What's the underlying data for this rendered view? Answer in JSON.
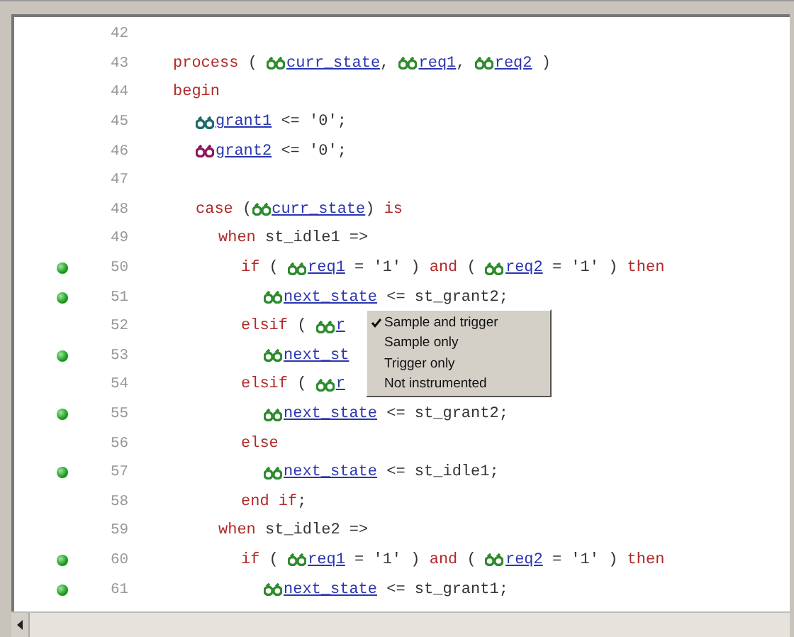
{
  "editor": {
    "lines": [
      {
        "number": "42",
        "breakpoint": false
      },
      {
        "number": "43",
        "breakpoint": false,
        "tokens": [
          {
            "kind": "keyword",
            "text": "process"
          },
          {
            "kind": "plain",
            "text": " ( "
          },
          {
            "kind": "signal",
            "text": "curr_state",
            "color": "#2e8b2e"
          },
          {
            "kind": "plain",
            "text": ", "
          },
          {
            "kind": "signal",
            "text": "req1",
            "color": "#2e8b2e"
          },
          {
            "kind": "plain",
            "text": ", "
          },
          {
            "kind": "signal",
            "text": "req2",
            "color": "#2e8b2e"
          },
          {
            "kind": "plain",
            "text": " )"
          }
        ]
      },
      {
        "number": "44",
        "breakpoint": false,
        "tokens": [
          {
            "kind": "keyword",
            "text": "begin"
          }
        ],
        "children": [
          {
            "number": "45",
            "breakpoint": false,
            "tokens": [
              {
                "kind": "signal",
                "text": "grant1",
                "color": "#1f6b6b"
              },
              {
                "kind": "plain",
                "text": " <= '0';"
              }
            ]
          },
          {
            "number": "46",
            "breakpoint": false,
            "tokens": [
              {
                "kind": "signal",
                "text": "grant2",
                "color": "#8b1a5c"
              },
              {
                "kind": "plain",
                "text": " <= '0';"
              }
            ]
          },
          {
            "number": "47",
            "breakpoint": false
          },
          {
            "number": "48",
            "breakpoint": false,
            "tokens": [
              {
                "kind": "keyword",
                "text": "case"
              },
              {
                "kind": "plain",
                "text": " ("
              },
              {
                "kind": "signal",
                "text": "curr_state",
                "color": "#2e8b2e"
              },
              {
                "kind": "plain",
                "text": ") "
              },
              {
                "kind": "keyword",
                "text": "is"
              }
            ],
            "children": [
              {
                "number": "49",
                "breakpoint": false,
                "tokens": [
                  {
                    "kind": "keyword",
                    "text": "when"
                  },
                  {
                    "kind": "plain",
                    "text": " st_idle1 =>"
                  }
                ],
                "children": [
                  {
                    "number": "50",
                    "breakpoint": true,
                    "tokens": [
                      {
                        "kind": "keyword",
                        "text": "if"
                      },
                      {
                        "kind": "plain",
                        "text": " ( "
                      },
                      {
                        "kind": "signal",
                        "text": "req1",
                        "color": "#2e8b2e"
                      },
                      {
                        "kind": "plain",
                        "text": " = '1' ) "
                      },
                      {
                        "kind": "keyword",
                        "text": "and"
                      },
                      {
                        "kind": "plain",
                        "text": " ( "
                      },
                      {
                        "kind": "signal",
                        "text": "req2",
                        "color": "#2e8b2e"
                      },
                      {
                        "kind": "plain",
                        "text": " = '1' ) "
                      },
                      {
                        "kind": "keyword",
                        "text": "then"
                      }
                    ],
                    "children": [
                      {
                        "number": "51",
                        "breakpoint": true,
                        "tokens": [
                          {
                            "kind": "signal",
                            "text": "next_state",
                            "color": "#2e8b2e"
                          },
                          {
                            "kind": "plain",
                            "text": " <= st_grant2;"
                          }
                        ]
                      }
                    ]
                  },
                  {
                    "number": "52",
                    "breakpoint": false,
                    "tokens": [
                      {
                        "kind": "keyword",
                        "text": "elsif"
                      },
                      {
                        "kind": "plain",
                        "text": " ( "
                      },
                      {
                        "kind": "signal",
                        "text": "r",
                        "color": "#2e8b2e"
                      }
                    ],
                    "children": [
                      {
                        "number": "53",
                        "breakpoint": true,
                        "tokens": [
                          {
                            "kind": "signal",
                            "text": "next_st",
                            "color": "#2e8b2e"
                          }
                        ]
                      }
                    ]
                  },
                  {
                    "number": "54",
                    "breakpoint": false,
                    "tokens": [
                      {
                        "kind": "keyword",
                        "text": "elsif"
                      },
                      {
                        "kind": "plain",
                        "text": " ( "
                      },
                      {
                        "kind": "signal",
                        "text": "r",
                        "color": "#2e8b2e"
                      }
                    ],
                    "children": [
                      {
                        "number": "55",
                        "breakpoint": true,
                        "tokens": [
                          {
                            "kind": "signal",
                            "text": "next_state",
                            "color": "#2e8b2e"
                          },
                          {
                            "kind": "plain",
                            "text": " <= st_grant2;"
                          }
                        ]
                      }
                    ]
                  },
                  {
                    "number": "56",
                    "breakpoint": false,
                    "tokens": [
                      {
                        "kind": "keyword",
                        "text": "else"
                      }
                    ],
                    "children": [
                      {
                        "number": "57",
                        "breakpoint": true,
                        "tokens": [
                          {
                            "kind": "signal",
                            "text": "next_state",
                            "color": "#2e8b2e"
                          },
                          {
                            "kind": "plain",
                            "text": " <= st_idle1;"
                          }
                        ]
                      }
                    ]
                  },
                  {
                    "number": "58",
                    "breakpoint": false,
                    "tokens": [
                      {
                        "kind": "keyword",
                        "text": "end if"
                      },
                      {
                        "kind": "plain",
                        "text": ";"
                      }
                    ]
                  }
                ]
              },
              {
                "number": "59",
                "breakpoint": false,
                "tokens": [
                  {
                    "kind": "keyword",
                    "text": "when"
                  },
                  {
                    "kind": "plain",
                    "text": " st_idle2 =>"
                  }
                ],
                "children": [
                  {
                    "number": "60",
                    "breakpoint": true,
                    "tokens": [
                      {
                        "kind": "keyword",
                        "text": "if"
                      },
                      {
                        "kind": "plain",
                        "text": " ( "
                      },
                      {
                        "kind": "signal",
                        "text": "req1",
                        "color": "#2e8b2e"
                      },
                      {
                        "kind": "plain",
                        "text": " = '1' ) "
                      },
                      {
                        "kind": "keyword",
                        "text": "and"
                      },
                      {
                        "kind": "plain",
                        "text": " ( "
                      },
                      {
                        "kind": "signal",
                        "text": "req2",
                        "color": "#2e8b2e"
                      },
                      {
                        "kind": "plain",
                        "text": " = '1' ) "
                      },
                      {
                        "kind": "keyword",
                        "text": "then"
                      }
                    ],
                    "children": [
                      {
                        "number": "61",
                        "breakpoint": true,
                        "tokens": [
                          {
                            "kind": "signal",
                            "text": "next_state",
                            "color": "#2e8b2e"
                          },
                          {
                            "kind": "plain",
                            "text": " <= st_grant1;"
                          }
                        ]
                      }
                    ]
                  }
                ]
              }
            ]
          }
        ]
      }
    ]
  },
  "context_menu": {
    "items": [
      {
        "label": "Sample and trigger",
        "checked": true
      },
      {
        "label": "Sample only",
        "checked": false
      },
      {
        "label": "Trigger only",
        "checked": false
      },
      {
        "label": "Not instrumented",
        "checked": false
      }
    ]
  }
}
